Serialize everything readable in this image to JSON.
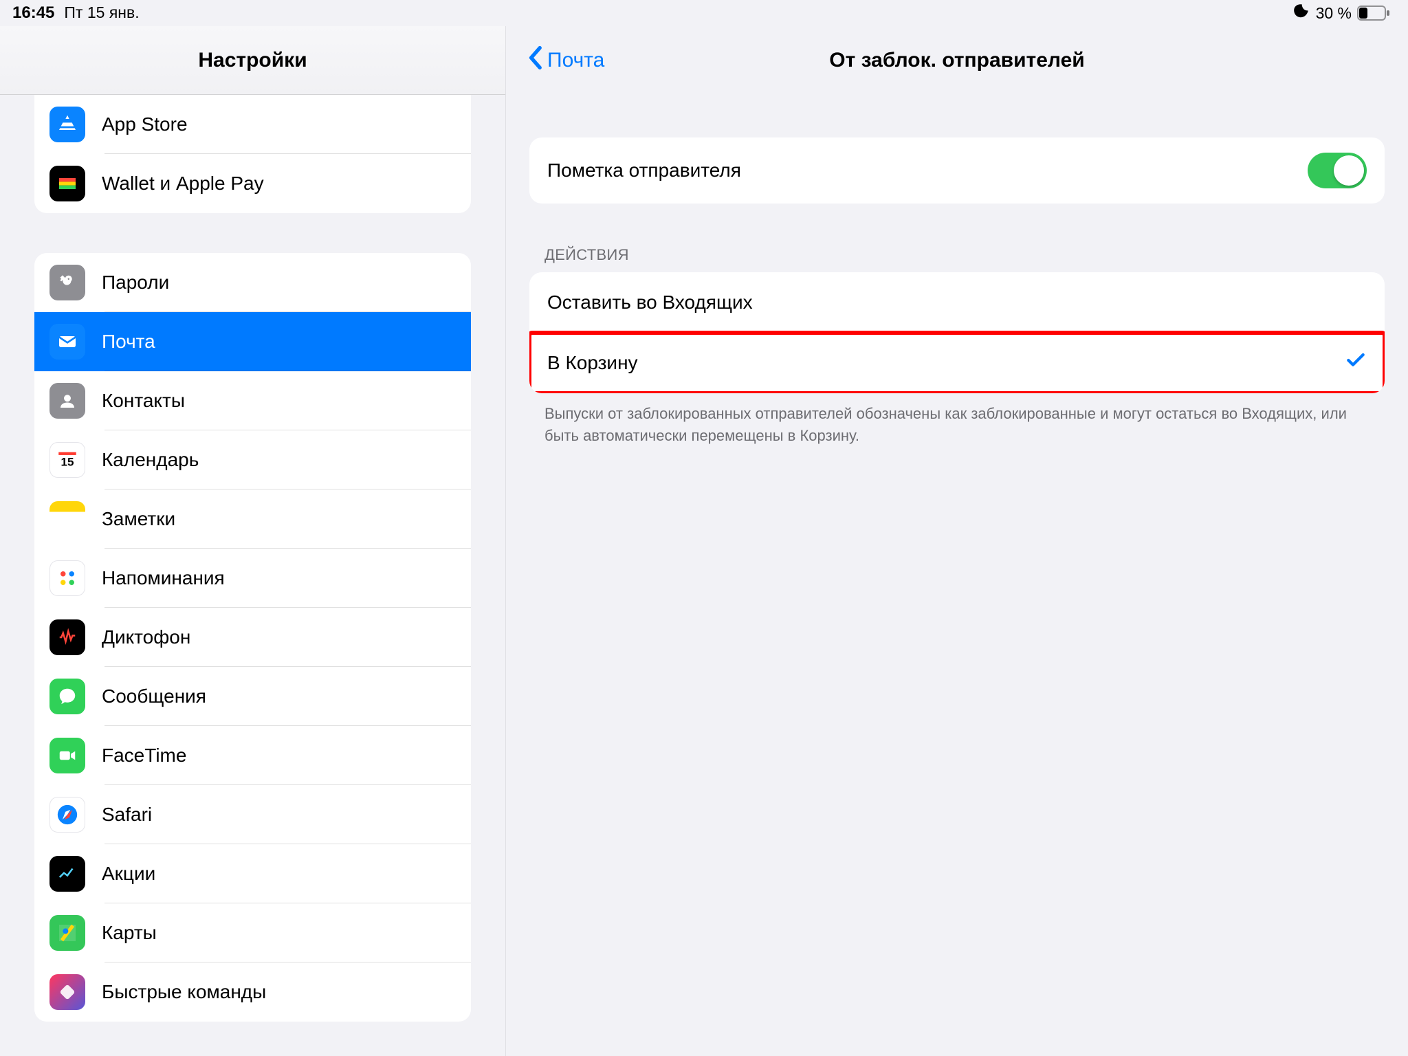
{
  "status": {
    "time": "16:45",
    "date": "Пт 15 янв.",
    "battery_text": "30 %"
  },
  "sidebar": {
    "title": "Настройки",
    "group0": [
      {
        "label": "App Store"
      },
      {
        "label": "Wallet и Apple Pay"
      }
    ],
    "group1": [
      {
        "label": "Пароли"
      },
      {
        "label": "Почта",
        "selected": true
      },
      {
        "label": "Контакты"
      },
      {
        "label": "Календарь"
      },
      {
        "label": "Заметки"
      },
      {
        "label": "Напоминания"
      },
      {
        "label": "Диктофон"
      },
      {
        "label": "Сообщения"
      },
      {
        "label": "FaceTime"
      },
      {
        "label": "Safari"
      },
      {
        "label": "Акции"
      },
      {
        "label": "Карты"
      },
      {
        "label": "Быстрые команды"
      }
    ]
  },
  "detail": {
    "back_label": "Почта",
    "title": "От заблок. отправителей",
    "section_toggle": {
      "label": "Пометка отправителя",
      "on": true
    },
    "section_actions": {
      "header": "ДЕЙСТВИЯ",
      "options": [
        {
          "label": "Оставить во Входящих",
          "checked": false
        },
        {
          "label": "В Корзину",
          "checked": true,
          "highlighted": true
        }
      ],
      "footer": "Выпуски от заблокированных отправителей обозначены как заблокированные и могут остаться во Входящих, или быть автоматически перемещены в Корзину."
    }
  }
}
